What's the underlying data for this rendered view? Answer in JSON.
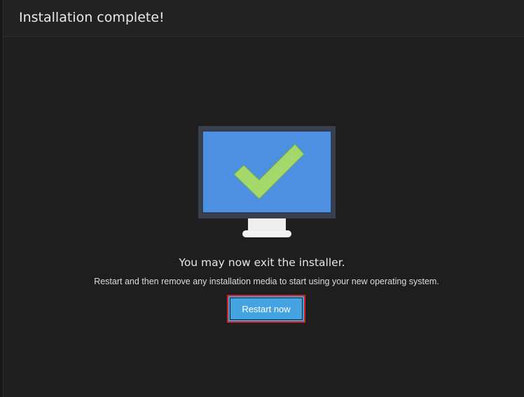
{
  "header": {
    "title": "Installation complete!"
  },
  "main": {
    "message": "You may now exit the installer.",
    "submessage": "Restart and then remove any installation media to start using your new operating system.",
    "restart_label": "Restart now"
  },
  "icons": {
    "illustration": "monitor-checkmark-icon"
  },
  "colors": {
    "background": "#1e1e1e",
    "header": "#222222",
    "monitor_bezel": "#3a3f4c",
    "monitor_screen": "#4d8fe0",
    "checkmark": "#a3d96a",
    "button": "#45a3e2",
    "button_focus_border": "#d42222"
  }
}
